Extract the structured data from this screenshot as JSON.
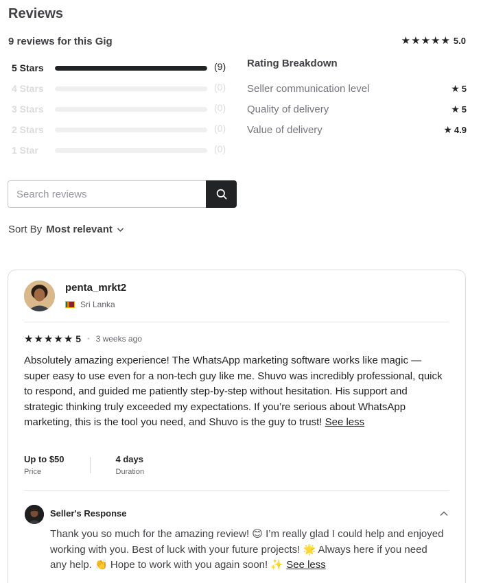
{
  "header": {
    "title": "Reviews",
    "count_text": "9 reviews for this Gig",
    "overall_rating": "5.0"
  },
  "bars": [
    {
      "label": "5 Stars",
      "count": "(9)",
      "fraction": 1.0
    },
    {
      "label": "4 Stars",
      "count": "(0)",
      "fraction": 0.0
    },
    {
      "label": "3 Stars",
      "count": "(0)",
      "fraction": 0.0
    },
    {
      "label": "2 Stars",
      "count": "(0)",
      "fraction": 0.0
    },
    {
      "label": "1 Star",
      "count": "(0)",
      "fraction": 0.0
    }
  ],
  "breakdown": {
    "title": "Rating Breakdown",
    "rows": [
      {
        "label": "Seller communication level",
        "value": "5"
      },
      {
        "label": "Quality of delivery",
        "value": "5"
      },
      {
        "label": "Value of delivery",
        "value": "4.9"
      }
    ]
  },
  "search": {
    "placeholder": "Search reviews",
    "icon": "search-icon"
  },
  "sort": {
    "label": "Sort By",
    "value": "Most relevant",
    "icon": "chevron-down-icon"
  },
  "review": {
    "username": "penta_mrkt2",
    "country": "Sri Lanka",
    "rating": "5",
    "time_ago": "3 weeks ago",
    "text": "Absolutely amazing experience! The WhatsApp marketing software works like magic — super easy to use even for a non-tech guy like me. Shuvo was incredibly professional, quick to respond, and guided me patiently step-by-step without hesitation. His support and strategic thinking truly exceeded my expectations. If you’re serious about WhatsApp marketing, this is the tool you need, and Shuvo is the guy to trust!",
    "see_less": "See less",
    "price_value": "Up to $50",
    "price_label": "Price",
    "duration_value": "4 days",
    "duration_label": "Duration"
  },
  "seller_response": {
    "title": "Seller's Response",
    "text": "Thank you so much for the amazing review! 😊 I’m really glad I could help and enjoyed working with you. Best of luck with your future projects! 🌟 Always here if you need any help. 👏 Hope to work with you again soon! ✨",
    "see_less": "See less"
  },
  "colors": {
    "text_dark": "#222325",
    "text_muted": "#74767e",
    "bar_empty": "#efeff0",
    "dim_label": "#dadbdd"
  }
}
